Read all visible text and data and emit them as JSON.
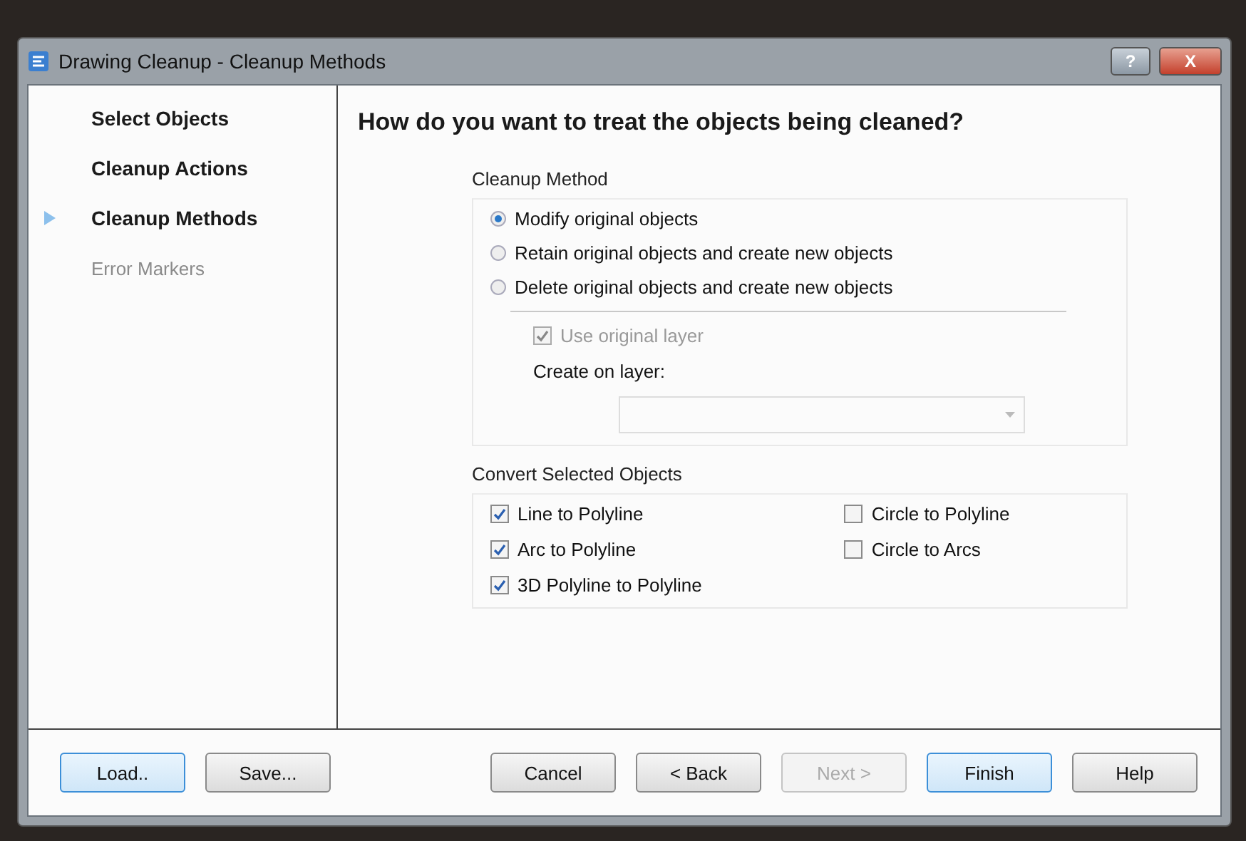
{
  "window": {
    "title": "Drawing Cleanup - Cleanup Methods",
    "help_button": "?",
    "close_button": "X"
  },
  "steps": [
    {
      "label": "Select Objects",
      "disabled": false,
      "selected": false
    },
    {
      "label": "Cleanup Actions",
      "disabled": false,
      "selected": false
    },
    {
      "label": "Cleanup Methods",
      "disabled": false,
      "selected": true
    },
    {
      "label": "Error Markers",
      "disabled": true,
      "selected": false
    }
  ],
  "heading": "How do you want to treat the objects being cleaned?",
  "cleanup_method": {
    "title": "Cleanup Method",
    "options": [
      {
        "label": "Modify original objects",
        "selected": true
      },
      {
        "label": "Retain original objects and create new objects",
        "selected": false
      },
      {
        "label": "Delete original objects and create new objects",
        "selected": false
      }
    ],
    "use_original_layer": {
      "label": "Use original layer",
      "checked": true,
      "disabled": true
    },
    "layer_label": "Create on layer:"
  },
  "convert": {
    "title": "Convert Selected Objects",
    "columns": [
      [
        {
          "label": "Line to Polyline",
          "checked": true
        },
        {
          "label": "Arc to Polyline",
          "checked": true
        },
        {
          "label": "3D Polyline to Polyline",
          "checked": true
        }
      ],
      [
        {
          "label": "Circle to Polyline",
          "checked": false
        },
        {
          "label": "Circle to Arcs",
          "checked": false
        }
      ]
    ]
  },
  "buttons_left": [
    {
      "label": "Load..",
      "disabled": false,
      "default": true
    },
    {
      "label": "Save...",
      "disabled": false,
      "default": false
    }
  ],
  "buttons_right": [
    {
      "label": "Cancel",
      "disabled": false,
      "default": false
    },
    {
      "label": "< Back",
      "disabled": false,
      "default": false
    },
    {
      "label": "Next >",
      "disabled": true,
      "default": false
    },
    {
      "label": "Finish",
      "disabled": false,
      "default": true
    },
    {
      "label": "Help",
      "disabled": false,
      "default": false
    }
  ]
}
